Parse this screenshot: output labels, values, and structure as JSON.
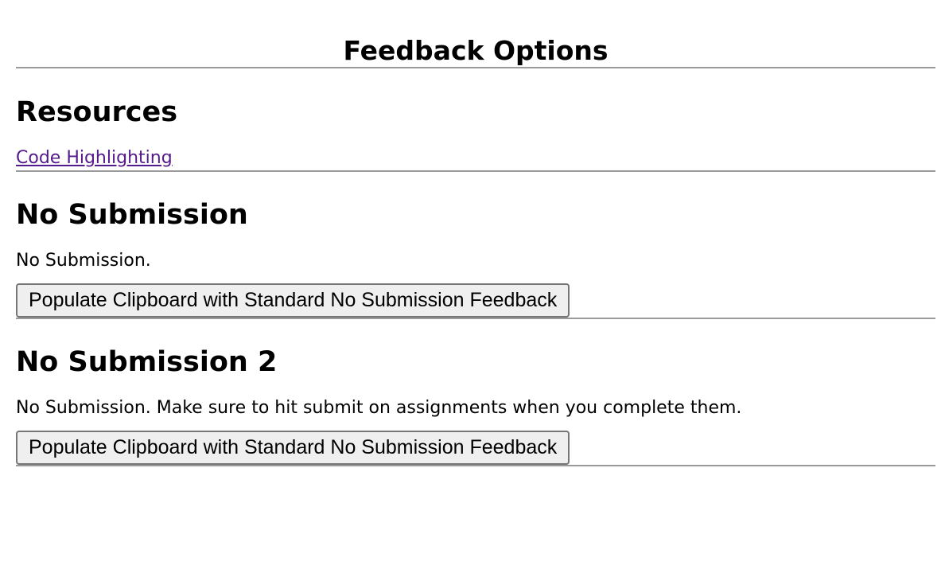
{
  "page": {
    "title": "Feedback Options"
  },
  "resources": {
    "heading": "Resources",
    "links": [
      {
        "label": "Code Highlighting"
      }
    ]
  },
  "sections": [
    {
      "heading": "No Submission",
      "description": "No Submission.",
      "button_label": "Populate Clipboard with Standard No Submission Feedback"
    },
    {
      "heading": "No Submission 2",
      "description": "No Submission. Make sure to hit submit on assignments when you complete them.",
      "button_label": "Populate Clipboard with Standard No Submission Feedback"
    }
  ],
  "colors": {
    "link_visited": "#551a8b",
    "divider": "#9a9a9a",
    "button_bg": "#efefef",
    "button_border": "#767676"
  }
}
